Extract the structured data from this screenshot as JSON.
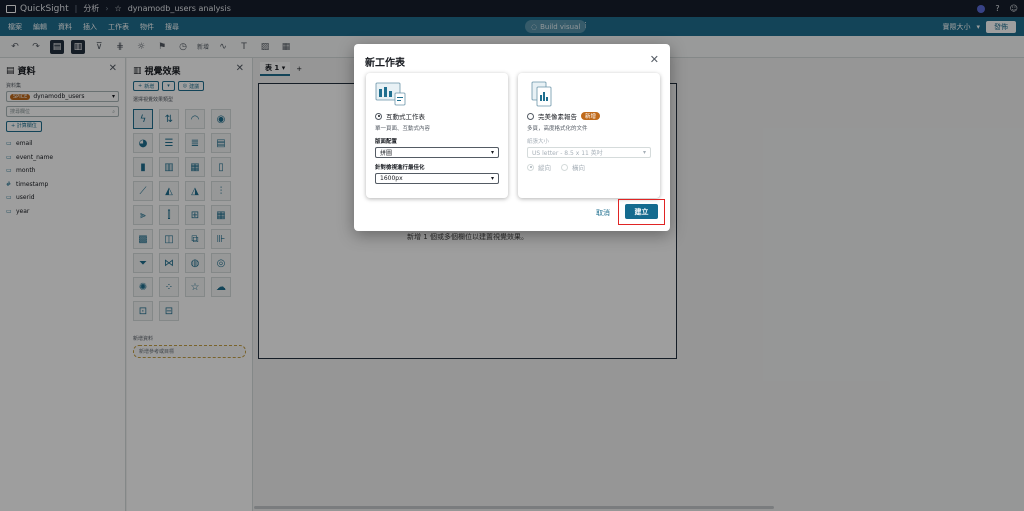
{
  "topbar": {
    "app_name": "QuickSight",
    "breadcrumb_analysis": "分析",
    "breadcrumb_name": "dynamodb_users analysis"
  },
  "menubar": {
    "items": [
      "檔案",
      "編輯",
      "資料",
      "插入",
      "工作表",
      "物件",
      "搜尋"
    ],
    "build_visual": "Build visual",
    "zoom_label": "實際大小",
    "share_label": "發佈"
  },
  "toolbar": {
    "label_new": "新增"
  },
  "data_panel": {
    "title": "資料",
    "dataset_label": "資料集",
    "spice_badge": "SPICE",
    "dataset_name": "dynamodb_users",
    "search_placeholder": "搜尋欄位",
    "add_calc_field": "計算欄位",
    "fields": [
      {
        "icon": "dimension",
        "name": "email"
      },
      {
        "icon": "dimension",
        "name": "event_name"
      },
      {
        "icon": "dimension",
        "name": "month"
      },
      {
        "icon": "measure",
        "name": "timestamp"
      },
      {
        "icon": "dimension",
        "name": "userid"
      },
      {
        "icon": "dimension",
        "name": "year"
      }
    ]
  },
  "visual_panel": {
    "title": "視覺效果",
    "add_label": "新增",
    "suggest_label": "建議",
    "types_label": "選擇視覺效果類型",
    "reference_label": "新增資料",
    "reference_placeholder": "新增參考或目標"
  },
  "canvas": {
    "tab_label": "表 1",
    "empty_message": "新增 1 個或多個欄位以建置視覺效果。"
  },
  "modal": {
    "title": "新工作表",
    "interactive": {
      "label": "互動式工作表",
      "description": "單一頁面、互動式內容",
      "layout_label": "版面配置",
      "layout_value": "拼圖",
      "optimize_label": "針對檢視進行最佳化",
      "optimize_value": "1600px"
    },
    "pixel": {
      "label": "完美像素報告",
      "new_badge": "新增",
      "description": "多頁，高度格式化的文件",
      "paper_label": "紙張大小",
      "paper_value": "US letter - 8.5 x 11 英吋",
      "portrait": "縱向",
      "landscape": "橫向"
    },
    "cancel": "取消",
    "create": "建立"
  }
}
